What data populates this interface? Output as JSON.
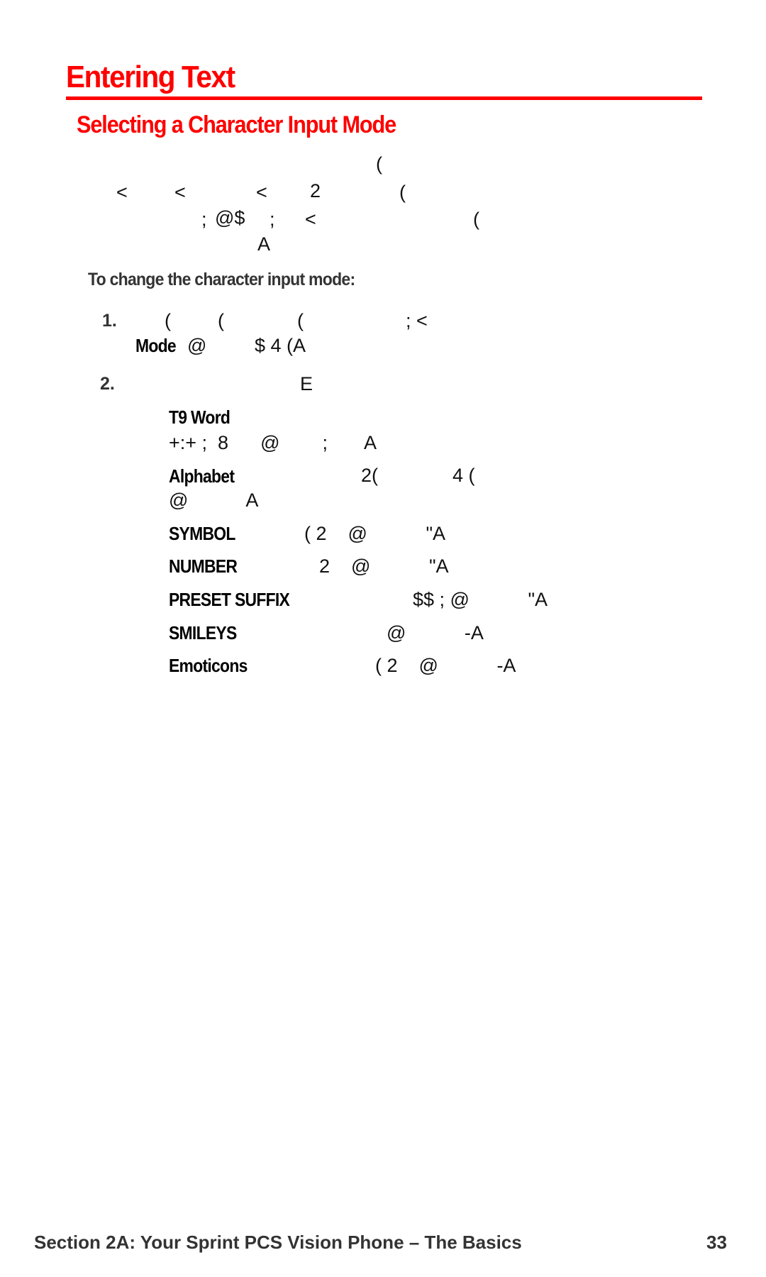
{
  "page": {
    "title": "Entering Text",
    "section_heading": "Selecting a Character Input Mode",
    "intro_glyph_lines": [
      [
        "("
      ],
      [
        "<",
        "<",
        "<",
        "2",
        "("
      ],
      [
        ";",
        "@$",
        ";",
        "<",
        "("
      ],
      [
        "A"
      ]
    ],
    "procedure_heading": "To change the character input mode:",
    "steps": [
      {
        "number": "1.",
        "line1_glyphs": [
          "(",
          "(",
          "(",
          "; <"
        ],
        "bold_label": "Mode",
        "line2_glyphs": [
          "@",
          "$ 4 (A"
        ]
      },
      {
        "number": "2.",
        "line1_glyphs": [
          "E"
        ]
      }
    ],
    "modes": [
      {
        "label": "T9 Word",
        "glyphs": "",
        "continuation": "+:+ ;  8      @        ;       A"
      },
      {
        "label": "Alphabet",
        "glyphs": "2(",
        "glyphs2": "4 (",
        "continuation": "@           A"
      },
      {
        "label": "SYMBOL",
        "glyphs": "( 2    @           \"A"
      },
      {
        "label": "NUMBER",
        "glyphs": "2    @           \"A"
      },
      {
        "label": "PRESET SUFFIX",
        "glyphs": "$$ ; @           \"A"
      },
      {
        "label": "SMILEYS",
        "glyphs": "@           -A"
      },
      {
        "label": "Emoticons",
        "glyphs": "( 2    @           -A"
      }
    ],
    "footer": {
      "section": "Section 2A: Your Sprint PCS Vision Phone – The Basics",
      "page_number": "33"
    }
  }
}
